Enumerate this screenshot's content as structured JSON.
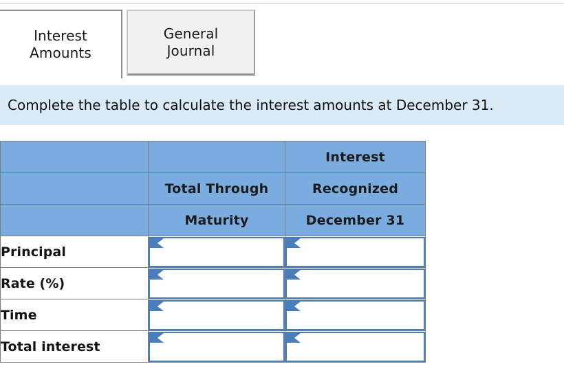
{
  "tabs": [
    {
      "label": "Interest\nAmounts",
      "state": "active",
      "name": "tab-interest-amounts"
    },
    {
      "label": "General\nJournal",
      "state": "inactive",
      "name": "tab-general-journal"
    }
  ],
  "banner": {
    "text": "Complete the table to calculate the interest amounts at December 31."
  },
  "table": {
    "header_rows": [
      [
        "",
        "",
        "Interest"
      ],
      [
        "",
        "Total Through",
        "Recognized"
      ],
      [
        "",
        "Maturity",
        "December 31"
      ]
    ],
    "rows": [
      {
        "label": "Principal",
        "maturity": "",
        "december": ""
      },
      {
        "label": "Rate (%)",
        "maturity": "",
        "december": ""
      },
      {
        "label": "Time",
        "maturity": "",
        "december": ""
      },
      {
        "label": "Total interest",
        "maturity": "",
        "december": ""
      }
    ],
    "input_placeholder": ""
  },
  "colors": {
    "header_blue": "#7bace0",
    "banner_blue": "#dbeaf7",
    "input_border": "#4a7ebb",
    "grid_line": "#7d7d7d"
  }
}
